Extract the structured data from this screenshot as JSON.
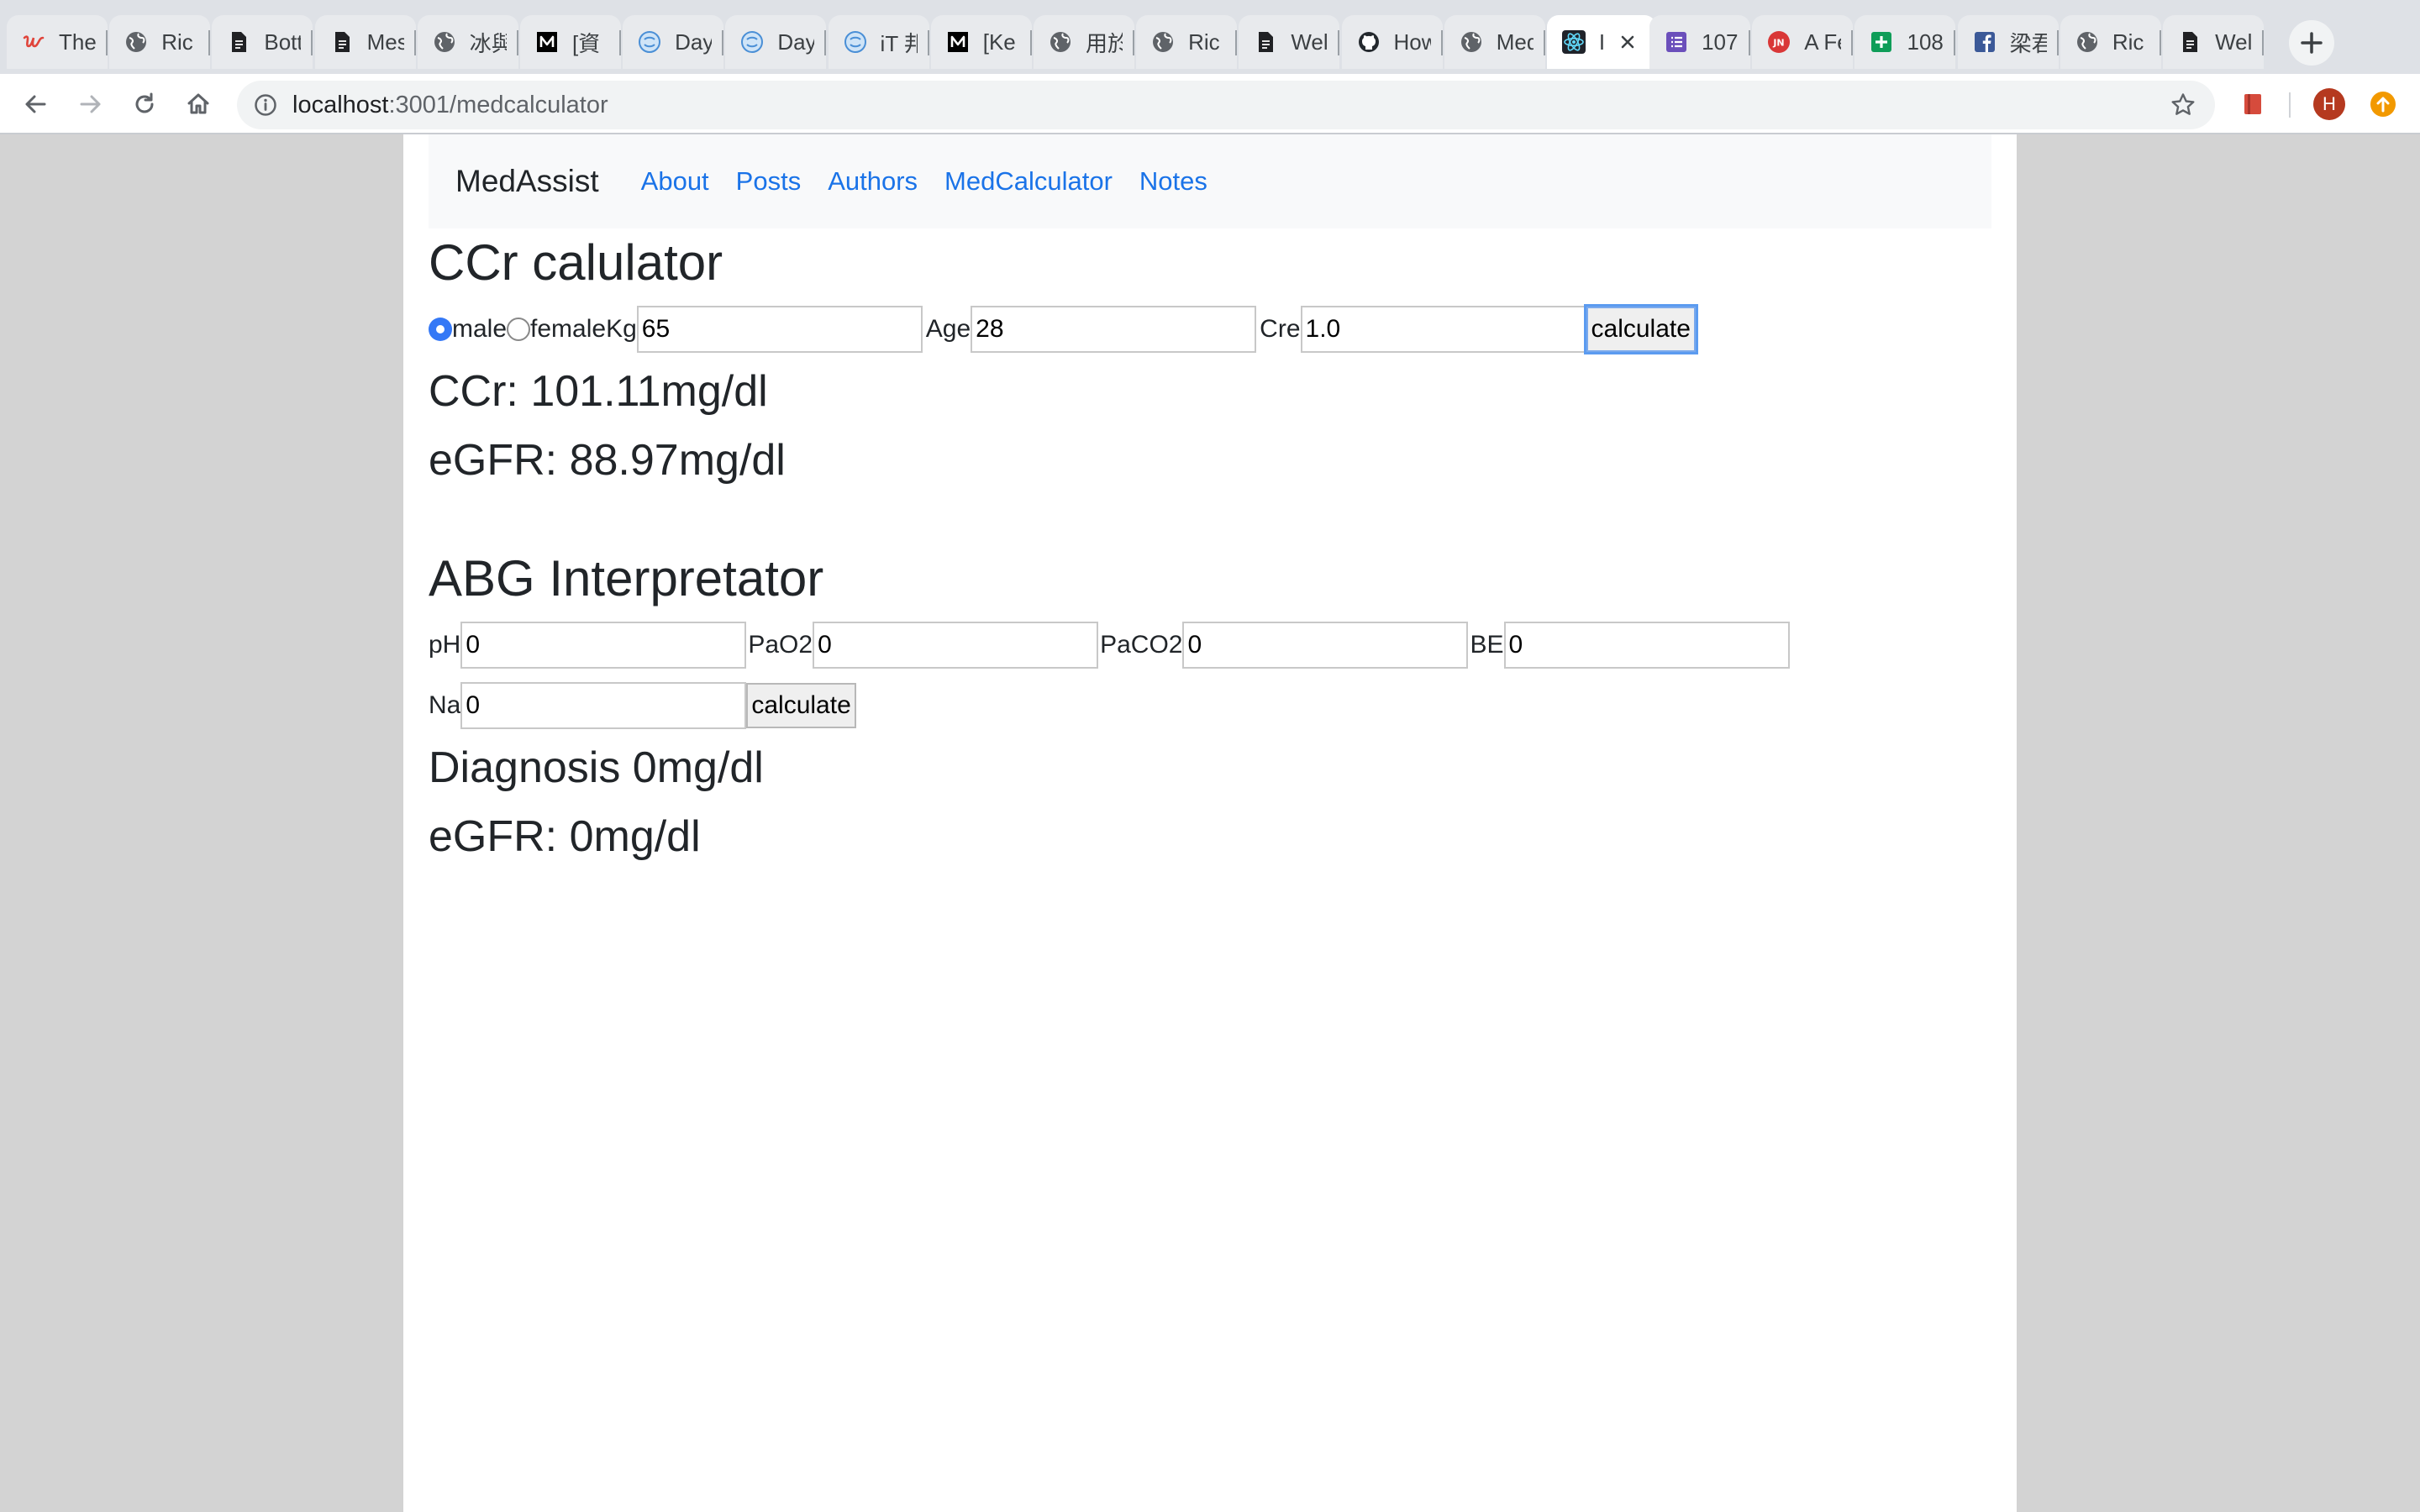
{
  "browser": {
    "tabs": [
      {
        "icon": "script-u-icon",
        "title": "The"
      },
      {
        "icon": "globe-icon",
        "title": "Ric"
      },
      {
        "icon": "document-icon",
        "title": "Bott"
      },
      {
        "icon": "document-icon",
        "title": "Mes"
      },
      {
        "icon": "globe-icon",
        "title": "冰與"
      },
      {
        "icon": "medium-icon",
        "title": "[資"
      },
      {
        "icon": "hexo-icon",
        "title": "Day"
      },
      {
        "icon": "hexo-icon",
        "title": "Day"
      },
      {
        "icon": "hexo-icon",
        "title": "iT 邦"
      },
      {
        "icon": "medium-icon",
        "title": "[Ke"
      },
      {
        "icon": "globe-icon",
        "title": "用於"
      },
      {
        "icon": "globe-icon",
        "title": "Ric"
      },
      {
        "icon": "document-icon",
        "title": "Wel"
      },
      {
        "icon": "github-icon",
        "title": "How"
      },
      {
        "icon": "globe-icon",
        "title": "Med"
      },
      {
        "icon": "react-icon",
        "title": "I",
        "active": true
      },
      {
        "icon": "list-icon",
        "title": "107"
      },
      {
        "icon": "jn-icon",
        "title": "A Fe"
      },
      {
        "icon": "sheets-plus-icon",
        "title": "108"
      },
      {
        "icon": "facebook-icon",
        "title": "梁君"
      },
      {
        "icon": "globe-icon",
        "title": "Ric"
      },
      {
        "icon": "document-icon",
        "title": "Wel"
      }
    ],
    "url_host": "localhost",
    "url_rest": ":3001/medcalculator",
    "profile_initial": "H"
  },
  "navbar": {
    "brand": "MedAssist",
    "links": [
      "About",
      "Posts",
      "Authors",
      "MedCalculator",
      "Notes"
    ]
  },
  "ccr": {
    "title": "CCr calulator",
    "male_label": "male",
    "female_label": "female",
    "kg_label": "Kg",
    "kg_value": "65",
    "age_label": "Age",
    "age_value": "28",
    "cre_label": "Cre",
    "cre_value": "1.0",
    "button_label": "calculate",
    "result_ccr": "CCr: 101.11mg/dl",
    "result_egfr": "eGFR: 88.97mg/dl"
  },
  "abg": {
    "title": "ABG Interpretator",
    "ph_label": "pH",
    "ph_value": "0",
    "pao2_label": "PaO2",
    "pao2_value": "0",
    "paco2_label": "PaCO2",
    "paco2_value": "0",
    "be_label": "BE",
    "be_value": "0",
    "na_label": "Na",
    "na_value": "0",
    "button_label": "calculate",
    "result_diagnosis": "Diagnosis 0mg/dl",
    "result_egfr": "eGFR: 0mg/dl"
  }
}
